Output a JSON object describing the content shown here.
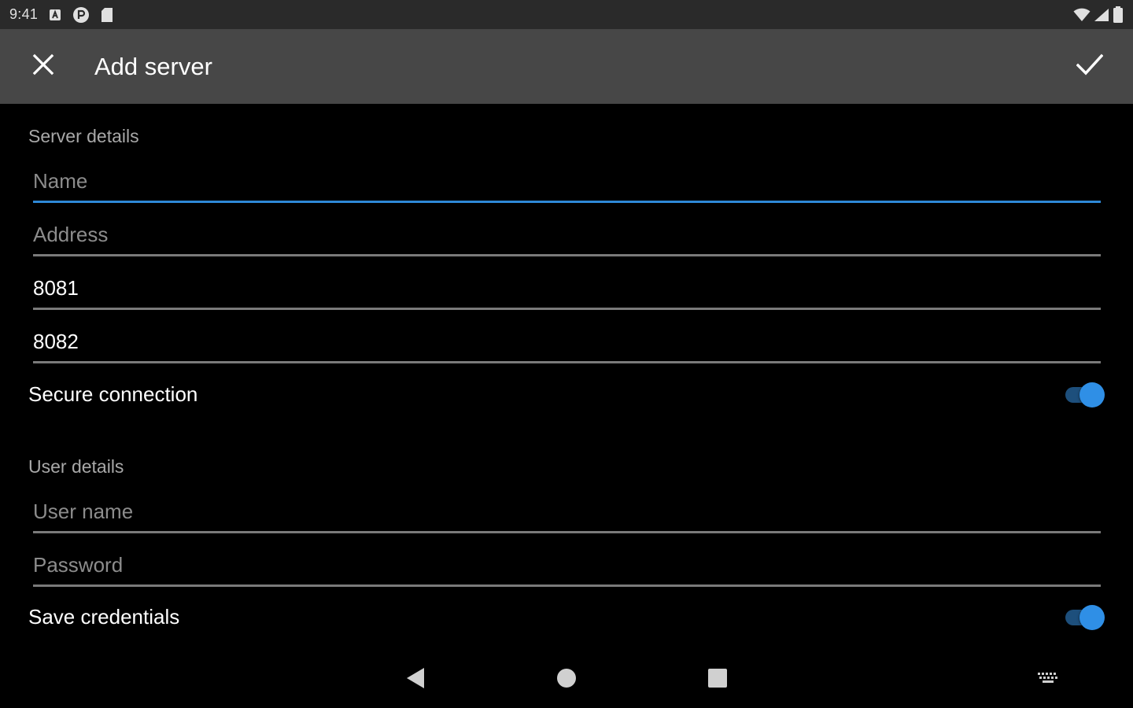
{
  "status_bar": {
    "time": "9:41",
    "icons": [
      "a-notification-icon",
      "p-notification-icon",
      "sd-card-icon"
    ],
    "right_icons": [
      "wifi-icon",
      "cellular-signal-icon",
      "battery-icon"
    ]
  },
  "app_bar": {
    "title": "Add server",
    "close_icon": "close-icon",
    "confirm_icon": "check-icon"
  },
  "server_details": {
    "section_label": "Server details",
    "name": {
      "value": "",
      "placeholder": "Name"
    },
    "address": {
      "value": "",
      "placeholder": "Address"
    },
    "port": {
      "value": "8081",
      "placeholder": ""
    },
    "secondary_port": {
      "value": "8082",
      "placeholder": ""
    },
    "secure_connection": {
      "label": "Secure connection",
      "enabled": true
    }
  },
  "user_details": {
    "section_label": "User details",
    "user_name": {
      "value": "",
      "placeholder": "User name"
    },
    "password": {
      "value": "",
      "placeholder": "Password"
    },
    "save_credentials": {
      "label": "Save credentials",
      "enabled": true
    }
  },
  "nav_bar": {
    "icons": [
      "back-icon",
      "home-icon",
      "recents-icon",
      "keyboard-icon"
    ]
  },
  "colors": {
    "accent": "#2e88d6",
    "switch_thumb": "#2f8fe6",
    "app_bar": "#474747",
    "status_bar": "#2a2a2a",
    "background": "#000000"
  }
}
